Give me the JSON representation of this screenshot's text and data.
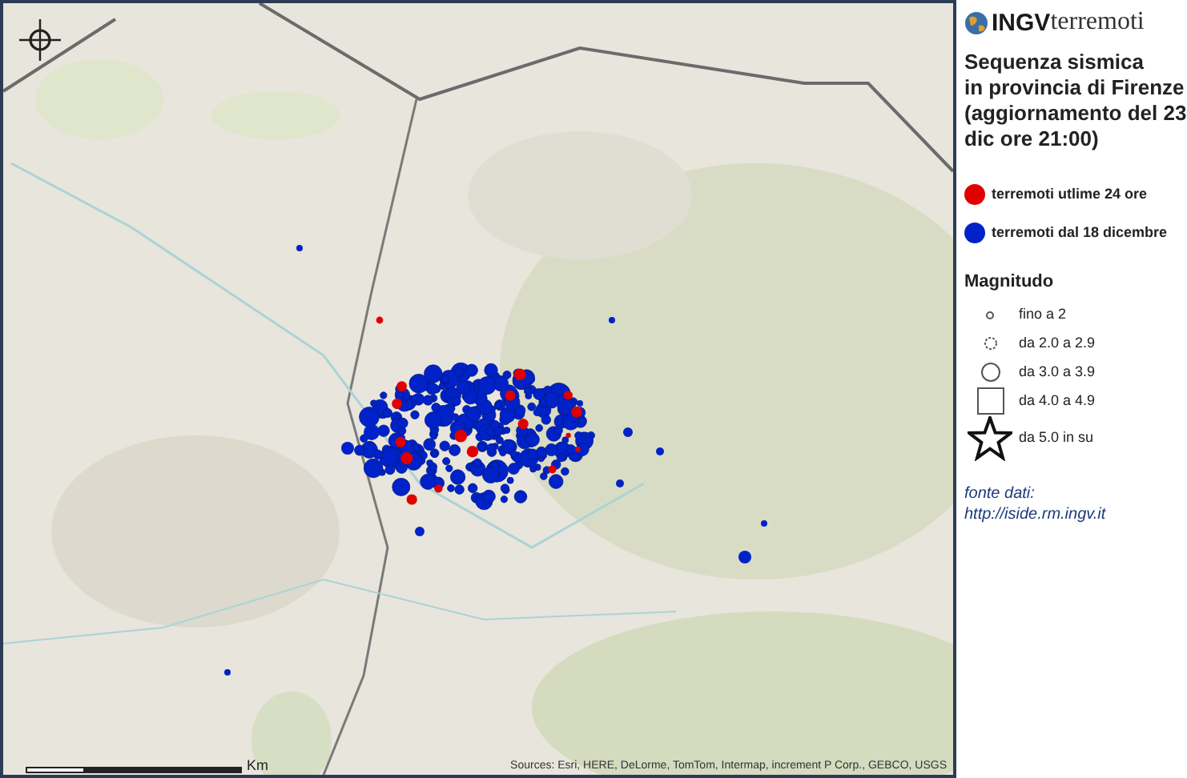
{
  "logo": {
    "brand": "INGV",
    "suffix": "terremoti"
  },
  "title_lines": [
    "Sequenza sismica",
    "in provincia di Firenze",
    "(aggiornamento del 23",
    "dic ore 21:00)"
  ],
  "legend": [
    {
      "label": "terremoti utlime 24 ore",
      "color": "#e00000"
    },
    {
      "label": "terremoti dal 18 dicembre",
      "color": "#0022c8"
    }
  ],
  "magnitude": {
    "title": "Magnitudo",
    "classes": [
      {
        "kind": "dot",
        "label": "fino a 2"
      },
      {
        "kind": "dotted-circle",
        "label": "da 2.0 a 2.9"
      },
      {
        "kind": "circle",
        "label": "da 3.0 a 3.9"
      },
      {
        "kind": "square",
        "label": "da 4.0 a 4.9"
      },
      {
        "kind": "star",
        "label": "da 5.0 in su"
      }
    ]
  },
  "source": {
    "label": "fonte dati:",
    "url": "http://iside.rm.ingv.it"
  },
  "map": {
    "attribution": "Sources: Esri, HERE, DeLorme, TomTom, Intermap, increment P Corp., GEBCO, USGS",
    "scale_unit": "Km"
  }
}
